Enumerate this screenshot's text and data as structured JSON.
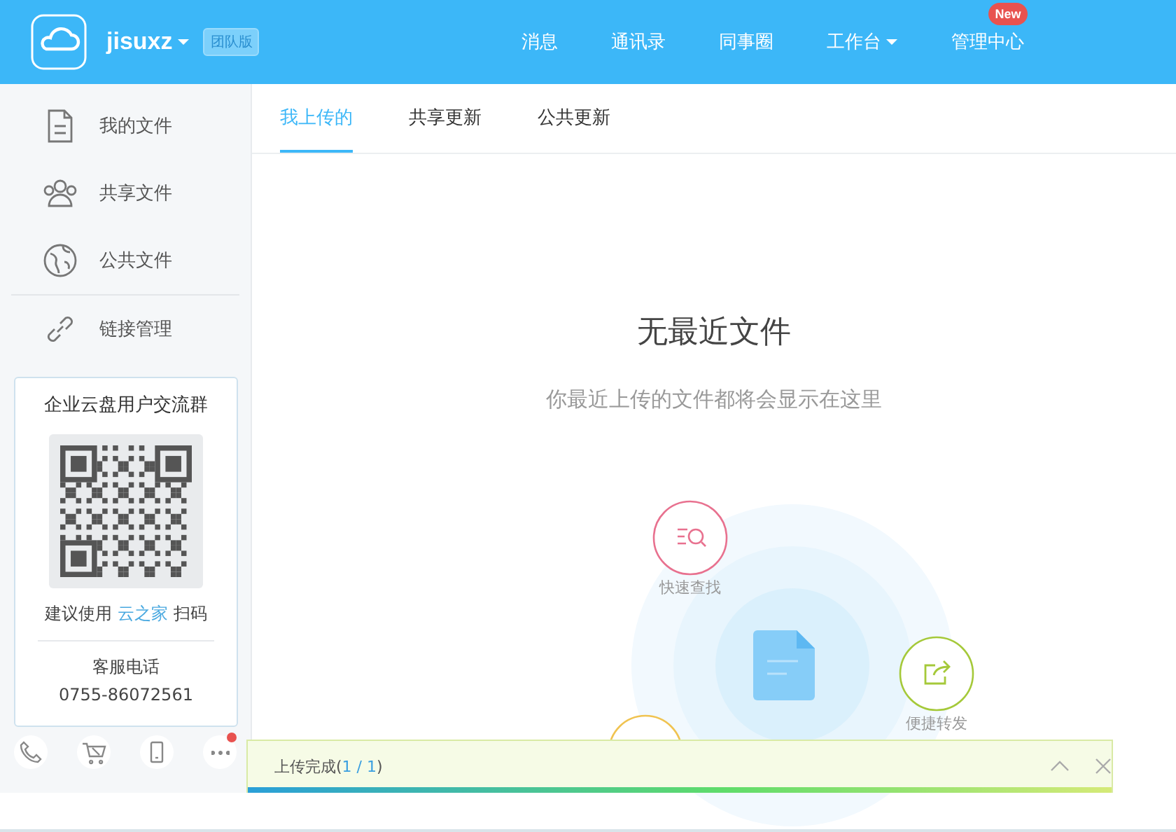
{
  "header": {
    "user": "jisuxz",
    "user_menu": true,
    "edition": "团队版",
    "nav": [
      {
        "label": "消息",
        "dropdown": false
      },
      {
        "label": "通讯录",
        "dropdown": false
      },
      {
        "label": "同事圈",
        "dropdown": false
      },
      {
        "label": "工作台",
        "dropdown": true
      },
      {
        "label": "管理中心",
        "dropdown": false,
        "badge": "New"
      }
    ]
  },
  "sidebar": {
    "items": [
      {
        "kind": "file",
        "label": "我的文件"
      },
      {
        "kind": "shared",
        "label": "共享文件"
      },
      {
        "kind": "public",
        "label": "公共文件"
      },
      {
        "kind": "link",
        "label": "链接管理"
      }
    ],
    "card": {
      "title": "企业云盘用户交流群",
      "hint_before": "建议使用",
      "hint_link": "云之家",
      "hint_after": "扫码",
      "phone_label": "客服电话",
      "phone": "0755-86072561"
    },
    "tools": [
      {
        "kind": "phone",
        "notification": false
      },
      {
        "kind": "cart",
        "notification": false
      },
      {
        "kind": "mobile",
        "notification": false
      },
      {
        "kind": "more",
        "notification": true
      }
    ]
  },
  "tabs": [
    {
      "label": "我上传的",
      "selected": true
    },
    {
      "label": "共享更新",
      "selected": false
    },
    {
      "label": "公共更新",
      "selected": false
    }
  ],
  "empty": {
    "title": "无最近文件",
    "subtitle": "你最近上传的文件都将会显示在这里",
    "features": [
      {
        "kind": "search",
        "label": "快速查找"
      },
      {
        "kind": "share",
        "label": "便捷转发"
      },
      {
        "kind": "other"
      }
    ]
  },
  "upload": {
    "prefix": "上传完成(",
    "count": "1 / 1",
    "suffix": ")",
    "level": 1
  }
}
